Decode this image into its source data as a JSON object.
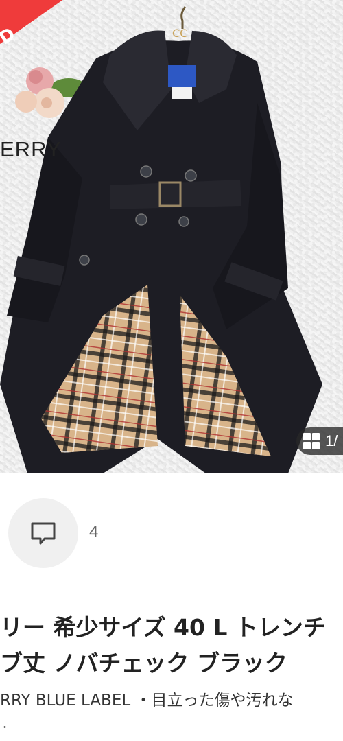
{
  "photo": {
    "sold_badge_text": "D",
    "brand_overlay_text": "ERRY",
    "logo_text": "CC"
  },
  "gallery": {
    "counter_text": "1/",
    "grid_icon": "grid-icon"
  },
  "comments": {
    "icon": "comment-icon",
    "count": "4"
  },
  "item": {
    "title_line_1": "リー 希少サイズ 40 L トレンチ",
    "title_line_2": "ブ丈 ノバチェック ブラック",
    "description": "RRY BLUE LABEL ・目立った傷や汚れな",
    "tail_mark": "・"
  },
  "colors": {
    "sold_red": "#ef3b3b",
    "coat_black": "#1d1d24",
    "check_beige": "#d8b48a"
  }
}
